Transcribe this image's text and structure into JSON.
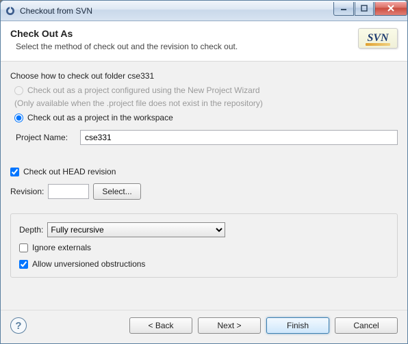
{
  "window": {
    "title": "Checkout from SVN"
  },
  "header": {
    "title": "Check Out As",
    "subtitle": "Select the method of check out and the revision to check out.",
    "logo_text": "SVN"
  },
  "body": {
    "choose_prompt": "Choose how to check out folder cse331",
    "radio_configured": "Check out as a project configured using the New Project Wizard",
    "configured_hint": "(Only available when the .project file does not exist in the repository)",
    "radio_workspace": "Check out as a project in the workspace",
    "project_name_label": "Project Name:",
    "project_name_value": "cse331",
    "head_revision_label": "Check out HEAD revision",
    "revision_label": "Revision:",
    "revision_value": "",
    "select_btn": "Select...",
    "depth_label": "Depth:",
    "depth_value": "Fully recursive",
    "ignore_externals_label": "Ignore externals",
    "allow_unversioned_label": "Allow unversioned obstructions"
  },
  "footer": {
    "back": "< Back",
    "next": "Next >",
    "finish": "Finish",
    "cancel": "Cancel"
  }
}
